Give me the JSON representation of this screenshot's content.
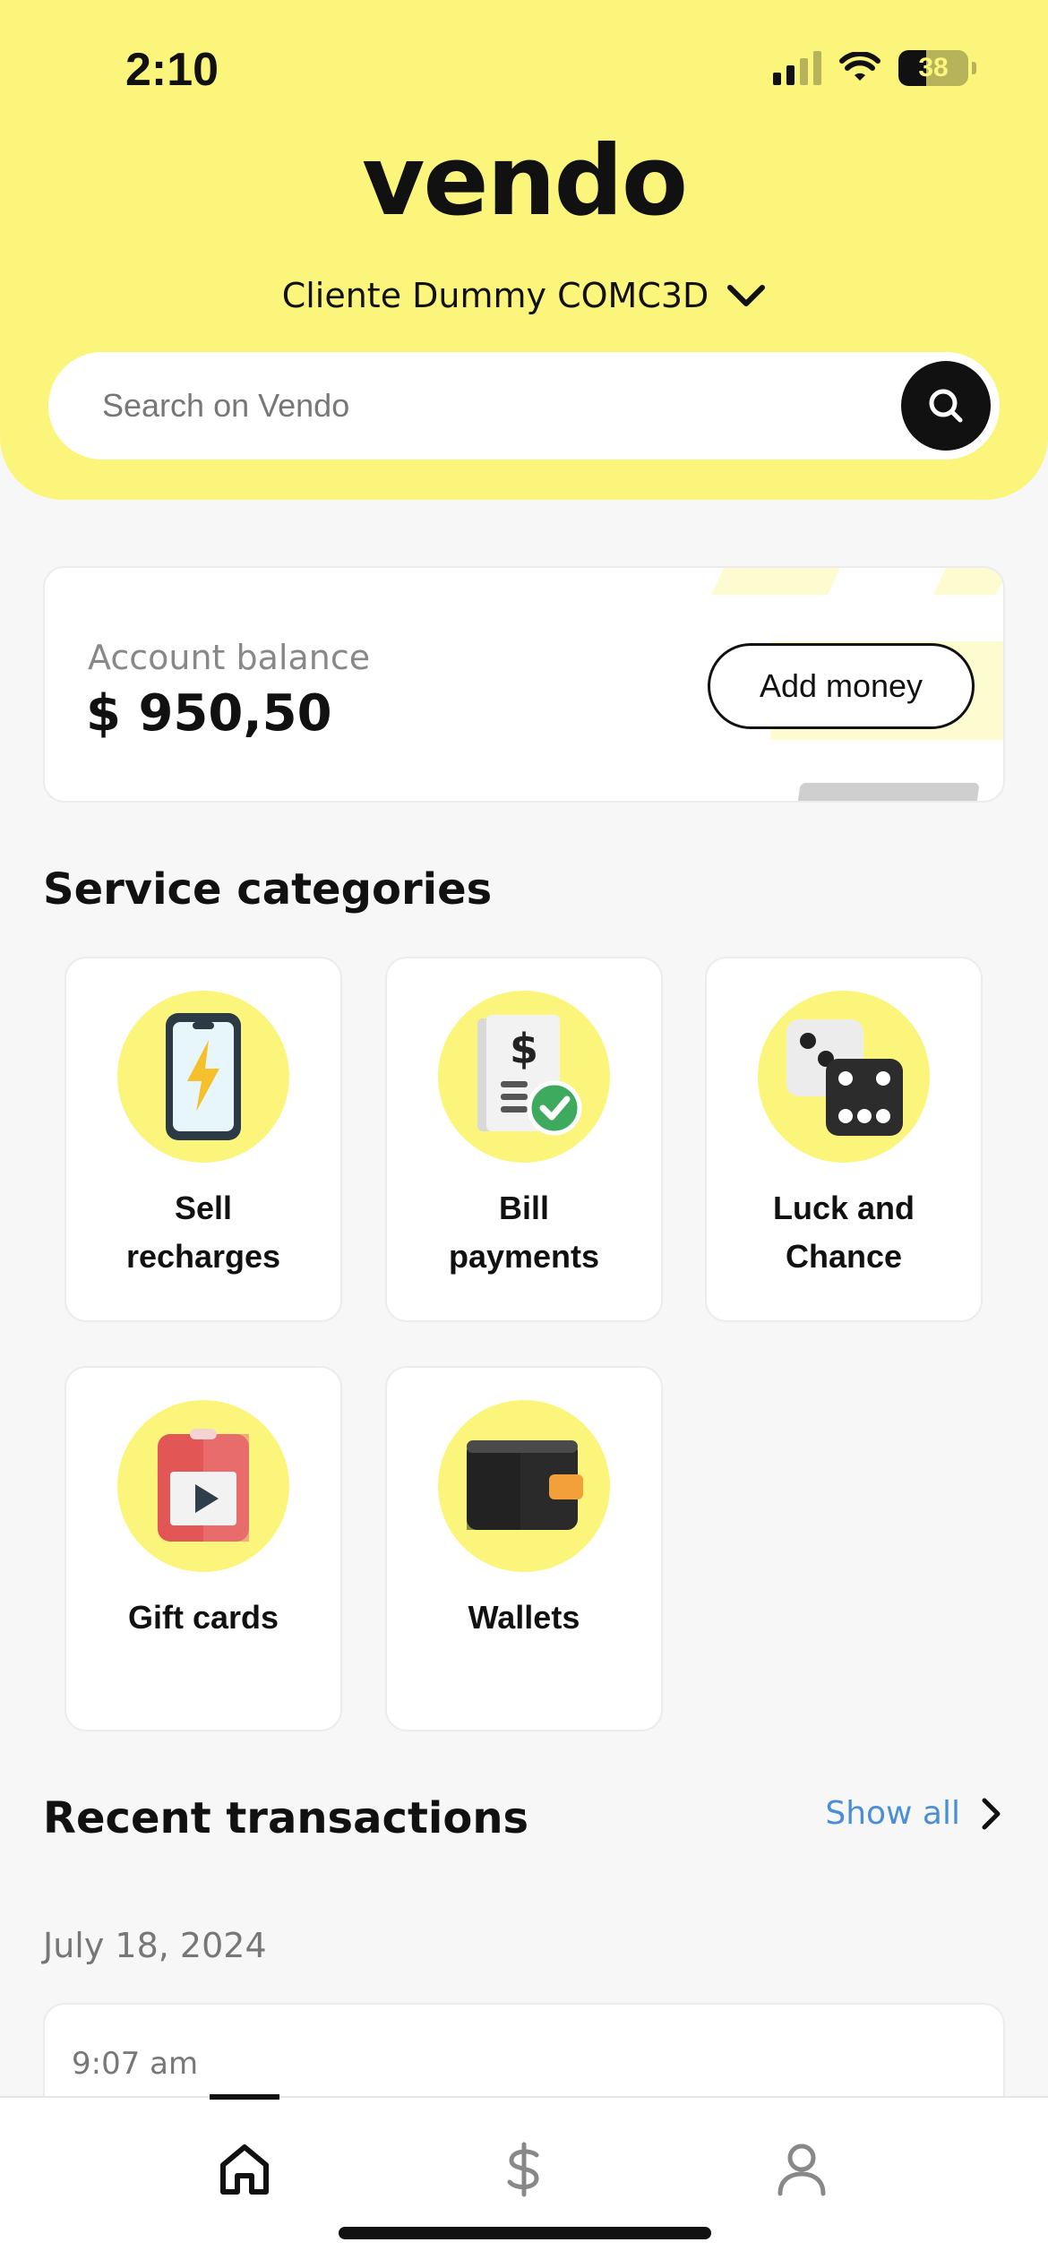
{
  "status_bar": {
    "time": "2:10",
    "battery_percent": "38",
    "battery_level": 0.38,
    "signal_bars_active": 2,
    "icons": [
      "signal-icon",
      "wifi-icon",
      "battery-icon"
    ]
  },
  "header": {
    "logo_text": "vendo",
    "client_name": "Cliente Dummy COMC3D",
    "client_dropdown_icon": "chevron-down-icon"
  },
  "search": {
    "placeholder": "Search on Vendo",
    "button_icon": "search-icon"
  },
  "balance": {
    "label": "Account balance",
    "amount": "$ 950,50",
    "add_money_label": "Add money"
  },
  "categories": {
    "title": "Service categories",
    "items": [
      {
        "label_line1": "Sell",
        "label_line2": "recharges",
        "icon": "phone-lightning-icon"
      },
      {
        "label_line1": "Bill",
        "label_line2": "payments",
        "icon": "bill-check-icon"
      },
      {
        "label_line1": "Luck and",
        "label_line2": "Chance",
        "icon": "dice-icon"
      },
      {
        "label_line1": "Gift cards",
        "label_line2": "",
        "icon": "gift-card-icon"
      },
      {
        "label_line1": "Wallets",
        "label_line2": "",
        "icon": "wallet-icon"
      }
    ]
  },
  "transactions": {
    "title": "Recent transactions",
    "show_all_label": "Show all",
    "groups": [
      {
        "date": "July 18, 2024",
        "items": [
          {
            "time": "9:07 am"
          }
        ]
      }
    ]
  },
  "tabbar": {
    "items": [
      {
        "icon": "home-icon",
        "active": true
      },
      {
        "icon": "dollar-icon",
        "active": false
      },
      {
        "icon": "user-icon",
        "active": false
      }
    ]
  },
  "colors": {
    "brand_yellow": "#fbf67b",
    "accent_blue": "#4a8fd6",
    "text_dark": "#111111"
  }
}
